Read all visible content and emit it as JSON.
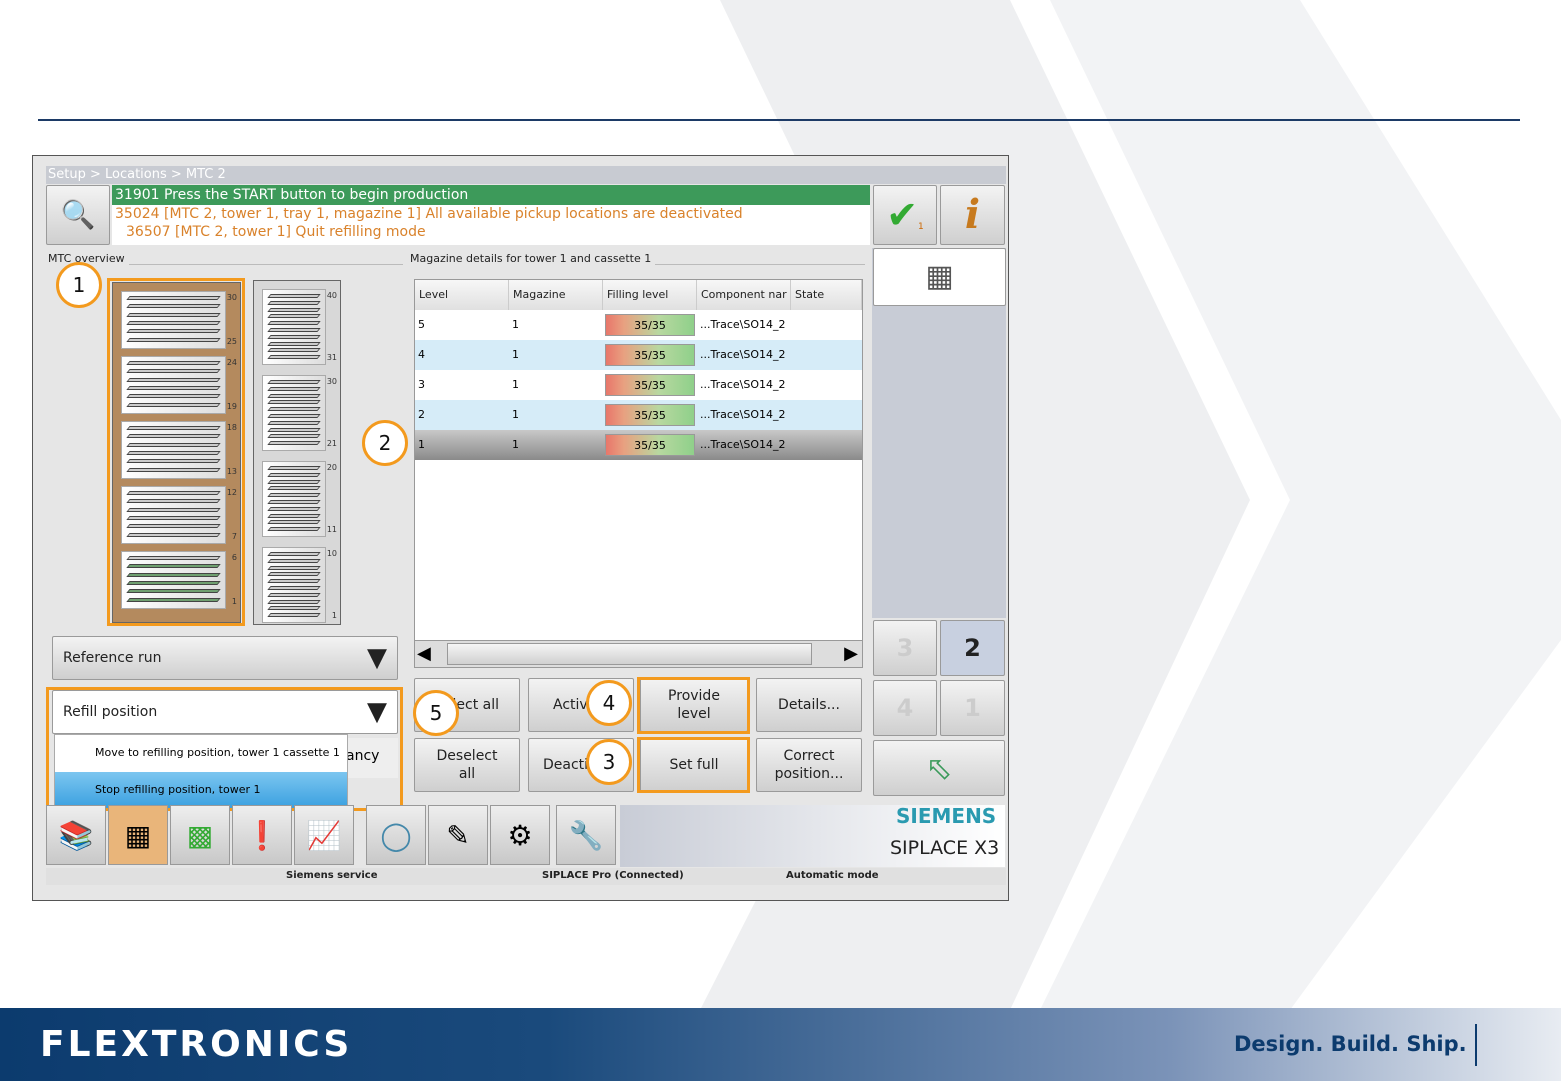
{
  "breadcrumb": "Setup > Locations > MTC 2",
  "messages": {
    "green": "31901 Press the START button to begin production",
    "orange1": "35024 [MTC 2, tower 1, tray 1, magazine 1] All available pickup locations are deactivated",
    "orange2": "36507 [MTC 2, tower 1] Quit refilling mode",
    "check_count": "1"
  },
  "sections": {
    "overview": "MTC overview",
    "details": "Magazine details for tower 1 and cassette 1"
  },
  "tower1": {
    "cassettes": [
      {
        "top": "30",
        "bottom": "25"
      },
      {
        "top": "24",
        "bottom": "19"
      },
      {
        "top": "18",
        "bottom": "13"
      },
      {
        "top": "12",
        "bottom": "7"
      },
      {
        "top": "6",
        "bottom": "1"
      }
    ]
  },
  "tower2": {
    "cassettes": [
      {
        "top": "40",
        "bottom": "31"
      },
      {
        "top": "30",
        "bottom": "21"
      },
      {
        "top": "20",
        "bottom": "11"
      },
      {
        "top": "10",
        "bottom": "1"
      }
    ]
  },
  "table": {
    "headers": [
      "Level",
      "Magazine",
      "Filling level",
      "Component nar",
      "State"
    ],
    "rows": [
      {
        "level": "5",
        "magazine": "1",
        "fill": "35/35",
        "component": "...Trace\\SO14_2"
      },
      {
        "level": "4",
        "magazine": "1",
        "fill": "35/35",
        "component": "...Trace\\SO14_2"
      },
      {
        "level": "3",
        "magazine": "1",
        "fill": "35/35",
        "component": "...Trace\\SO14_2"
      },
      {
        "level": "2",
        "magazine": "1",
        "fill": "35/35",
        "component": "...Trace\\SO14_2"
      },
      {
        "level": "1",
        "magazine": "1",
        "fill": "35/35",
        "component": "...Trace\\SO14_2"
      }
    ]
  },
  "dropdowns": {
    "reference": "Reference run",
    "refill": "Refill position",
    "options": [
      "Move to refilling position, tower 1 cassette 1",
      "Stop refilling position, tower 1"
    ],
    "hidden_partial": "ancy"
  },
  "buttons": {
    "select_all": "Select all",
    "activate": "Activ",
    "provide": "Provide level",
    "details": "Details...",
    "deselect_all": "Deselect all",
    "deactivate": "Deacti",
    "set_full": "Set full",
    "correct": "Correct position..."
  },
  "towers_nav": [
    "3",
    "2",
    "4",
    "1"
  ],
  "brand": {
    "siemens": "SIEMENS",
    "model": "SIPLACE X3"
  },
  "status": {
    "user": "Siemens service",
    "pro": "SIPLACE Pro (Connected)",
    "mode": "Automatic mode"
  },
  "annotations": [
    "1",
    "2",
    "3",
    "4",
    "5"
  ],
  "footer": {
    "logo": "FLEXTRONICS",
    "tagline": "Design. Build. Ship."
  },
  "colors": {
    "accent": "#f39a1e",
    "green": "#3d9a5a",
    "navy": "#0c3b6e"
  }
}
